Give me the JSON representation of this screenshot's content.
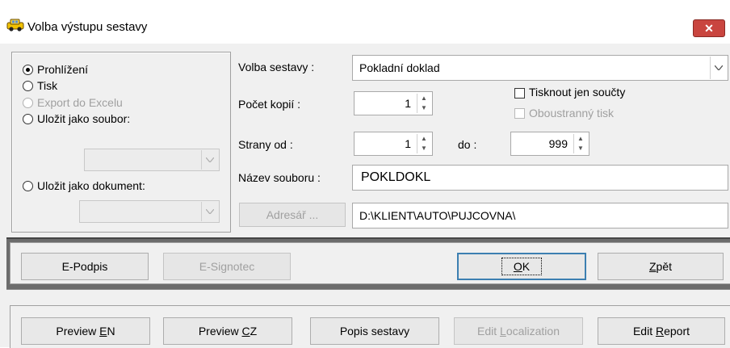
{
  "window": {
    "title": "Volba výstupu sestavy",
    "close_label": "✕"
  },
  "output": {
    "options": [
      {
        "label": "Prohlížení",
        "checked": true,
        "disabled": false
      },
      {
        "label": "Tisk",
        "checked": false,
        "disabled": false
      },
      {
        "label": "Export do Excelu",
        "checked": false,
        "disabled": true
      },
      {
        "label": "Uložit jako soubor:",
        "checked": false,
        "disabled": false
      },
      {
        "label": "Uložit jako dokument:",
        "checked": false,
        "disabled": false
      }
    ]
  },
  "form": {
    "report_label": "Volba sestavy :",
    "report_value": "Pokladní doklad",
    "copies_label": "Počet kopií :",
    "copies_value": "1",
    "print_totals_label": "Tisknout jen součty",
    "duplex_label": "Oboustranný tisk",
    "pages_from_label": "Strany od :",
    "pages_from_value": "1",
    "pages_to_label": "do :",
    "pages_to_value": "999",
    "filename_label": "Název souboru :",
    "filename_value": "POKLDOKL",
    "directory_button": "Adresář ...",
    "directory_value": "D:\\KLIENT\\AUTO\\PUJCOVNA\\"
  },
  "actions": {
    "epodpis": "E-Podpis",
    "esignotec": "E-Signotec",
    "ok_prefix": "O",
    "ok_rest": "K",
    "back_prefix": "Z",
    "back_rest": "pět"
  },
  "bottom": {
    "preview_en_a": "Preview ",
    "preview_en_b": "E",
    "preview_en_c": "N",
    "preview_cz_a": "Preview ",
    "preview_cz_b": "C",
    "preview_cz_c": "Z",
    "report_desc": "Popis sestavy",
    "edit_loc_a": "Edit ",
    "edit_loc_b": "L",
    "edit_loc_c": "ocalization",
    "edit_report_a": "Edit ",
    "edit_report_b": "R",
    "edit_report_c": "eport"
  },
  "colors": {
    "default_border": "#3c7fb1",
    "close_bg": "#c9453f",
    "band": "#6c6c6c"
  }
}
